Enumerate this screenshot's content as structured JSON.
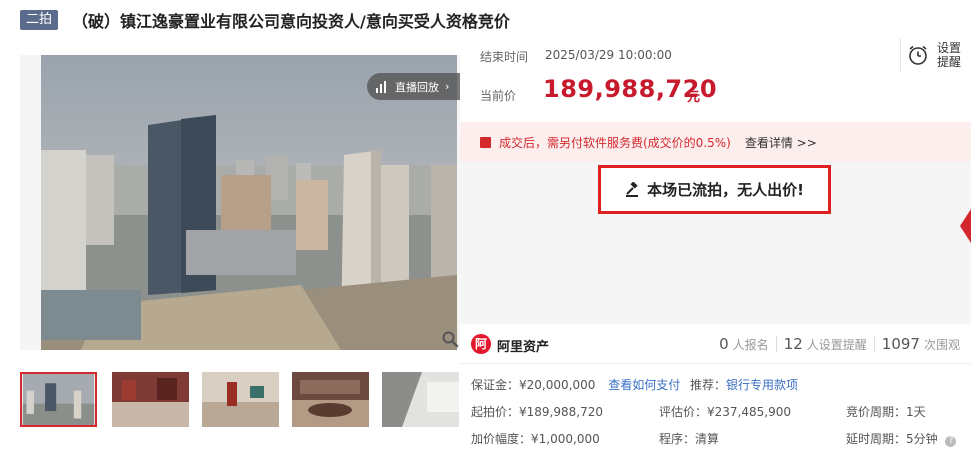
{
  "header": {
    "round_badge": "二拍",
    "title": "（破）镇江逸豪置业有限公司意向投资人/意向买受人资格竞价"
  },
  "gallery": {
    "replay_label": "直播回放",
    "replay_chevron": "›",
    "thumbnail_icons": [
      "city-aerial-photo",
      "red-lobby-photo",
      "interior-photo",
      "office-photo",
      "room-photo"
    ]
  },
  "auction": {
    "end_time_label": "结束时间",
    "end_time_value": "2025/03/29 10:00:00",
    "current_price_label": "当前价",
    "current_price_value": "189,988,720",
    "current_price_unit": "元",
    "remind_label": "设置提醒"
  },
  "notice": {
    "text": "成交后，需另付软件服务费(成交价的0.5%)",
    "link": "查看详情 >>"
  },
  "status": {
    "text": "本场已流拍，无人出价!"
  },
  "platform": {
    "logo_glyph": "阿",
    "name": "阿里资产"
  },
  "stats": {
    "registered_count": "0",
    "registered_label": "人报名",
    "reminder_count": "12",
    "reminder_label": "人设置提醒",
    "views_count": "1097",
    "views_label": "次围观"
  },
  "details": {
    "deposit_label": "保证金：",
    "deposit_value": "¥20,000,000",
    "deposit_link": "查看如何支付",
    "recommend_label": "推荐：",
    "recommend_link": "银行专用款项",
    "start_price_label": "起拍价：",
    "start_price_value": "¥189,988,720",
    "appraisal_label": "评估价：",
    "appraisal_value": "¥237,485,900",
    "bid_period_label": "竞价周期：",
    "bid_period_value": "1天",
    "increment_label": "加价幅度：",
    "increment_value": "¥1,000,000",
    "procedure_label": "程序：",
    "procedure_value": "清算",
    "extension_label": "延时周期：",
    "extension_value": "5分钟",
    "help_glyph": "?"
  },
  "colors": {
    "accent_red": "#c71a2c",
    "link_blue": "#3a6fc4",
    "badge_slate": "#5b6b8c"
  }
}
